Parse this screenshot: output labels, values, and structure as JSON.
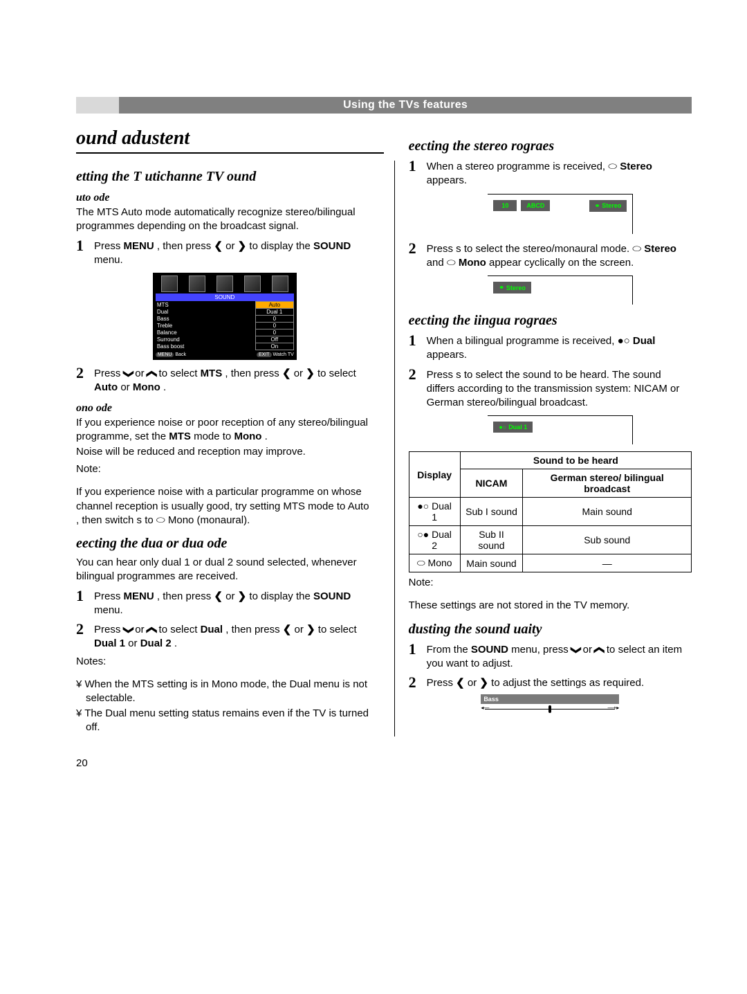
{
  "header": "Using the TVs features",
  "title": "ound adustent",
  "section1": {
    "heading": "etting the T utichanne TV ound",
    "auto": {
      "heading": "uto ode",
      "body": "The MTS Auto mode automatically recognize stereo/bilingual programmes depending on the broadcast signal.",
      "step1_a": "Press ",
      "step1_menu": "MENU",
      "step1_b": " , then press ",
      "step1_c": " or ",
      "step1_d": " to display the ",
      "step1_sound": "SOUND",
      "step1_e": "  menu."
    },
    "osd": {
      "title": "SOUND",
      "rows": [
        {
          "k": "MTS",
          "v": "Auto"
        },
        {
          "k": "Dual",
          "v": "Dual 1"
        },
        {
          "k": "Bass",
          "v": "0"
        },
        {
          "k": "Treble",
          "v": "0"
        },
        {
          "k": "Balance",
          "v": "0"
        },
        {
          "k": "Surround",
          "v": "Off"
        },
        {
          "k": "Bass boost",
          "v": "On"
        }
      ],
      "back_btn": "MENU",
      "back_lbl": "Back",
      "exit_btn": "EXIT",
      "exit_lbl": "Watch TV"
    },
    "step2_a": "Press ",
    "step2_b": " or ",
    "step2_c": " to select ",
    "step2_mts": "MTS",
    "step2_d": " , then press ",
    "step2_e": " or ",
    "step2_f": " to select ",
    "step2_auto": "Auto",
    "step2_g": "  or ",
    "step2_mono": "Mono",
    "step2_h": " .",
    "mono": {
      "heading": "ono ode",
      "p1_a": "If you experience noise or poor reception of any stereo/bilingual programme, set the ",
      "p1_mts": "MTS",
      "p1_b": "  mode to ",
      "p1_mono": "Mono",
      "p1_c": " .",
      "p2": "Noise will be reduced and reception may improve.",
      "note_label": "Note:",
      "note_body": "If you experience noise with a particular programme on whose channel reception is usually good, try setting MTS mode to Auto , then switch s        to ⬭ Mono (monaural)."
    }
  },
  "section_dual": {
    "heading": "eecting the dua  or dua  ode",
    "body": "You can hear only dual 1 or dual 2 sound selected, whenever bilingual programmes are received.",
    "step1_a": "Press ",
    "step1_menu": "MENU",
    "step1_b": " , then press ",
    "step1_c": " or ",
    "step1_d": " to display the ",
    "step1_sound": "SOUND",
    "step1_e": "  menu.",
    "step2_a": "Press ",
    "step2_b": " or ",
    "step2_c": " to select ",
    "step2_dual": "Dual",
    "step2_d": " , then press ",
    "step2_e": " or ",
    "step2_f": " to select ",
    "step2_d1": "Dual 1",
    "step2_g": "  or ",
    "step2_d2": "Dual 2",
    "step2_h": " .",
    "notes_label": "Notes:",
    "bullet1": "¥  When the MTS setting is in Mono  mode, the Dual  menu is not selectable.",
    "bullet2": "¥  The Dual  menu setting status remains even if the TV is turned off."
  },
  "section_stereo": {
    "heading": "eecting the stereo rograes",
    "step1_a": "When a stereo programme is received, ⬭ ",
    "step1_stereo": "Stereo",
    "step1_b": "  appears.",
    "snippet1": {
      "ch": "10",
      "name": "ABCD",
      "tag": "Stereo"
    },
    "step2_a": "Press s        to select the stereo/monaural mode. ⬭ ",
    "step2_stereo": "Stereo",
    "step2_b": "  and ⬭ ",
    "step2_mono": "Mono",
    "step2_c": "  appear cyclically on the screen.",
    "snippet2": {
      "tag": "Stereo"
    }
  },
  "section_bilingual": {
    "heading": "eecting the iingua rograes",
    "step1_a": "When a bilingual programme is received, ●○ ",
    "step1_dual": "Dual",
    "step1_b": "  appears.",
    "step2": "Press s        to select the sound to be heard. The sound differs according to the transmission system: NICAM or German stereo/bilingual broadcast.",
    "snippet": {
      "tag": "Dual  1"
    },
    "table": {
      "h_display": "Display",
      "h_sound": "Sound to be heard",
      "h_nicam": "NICAM",
      "h_german": "German stereo/ bilingual broadcast",
      "r1_disp": "●○ Dual 1",
      "r1_a": "Sub I sound",
      "r1_b": "Main sound",
      "r2_disp": "○● Dual 2",
      "r2_a": "Sub II sound",
      "r2_b": "Sub sound",
      "r3_disp": "⬭ Mono",
      "r3_a": "Main sound",
      "r3_b": "—"
    },
    "note_label": "Note:",
    "note_body": "These settings are not stored in the TV memory."
  },
  "section_quality": {
    "heading": "dusting the sound uaity",
    "step1_a": "From the ",
    "step1_sound": "SOUND",
    "step1_b": "  menu, press ",
    "step1_c": " or ",
    "step1_d": " to select an item you want to adjust.",
    "step2_a": "Press ",
    "step2_b": " or ",
    "step2_c": " to adjust the settings as required.",
    "slider_label": "Bass"
  },
  "page": "20",
  "glyphs": {
    "left": "❮",
    "right": "❯",
    "down": "❱",
    "up": "❰",
    "stereo": "⚭"
  }
}
